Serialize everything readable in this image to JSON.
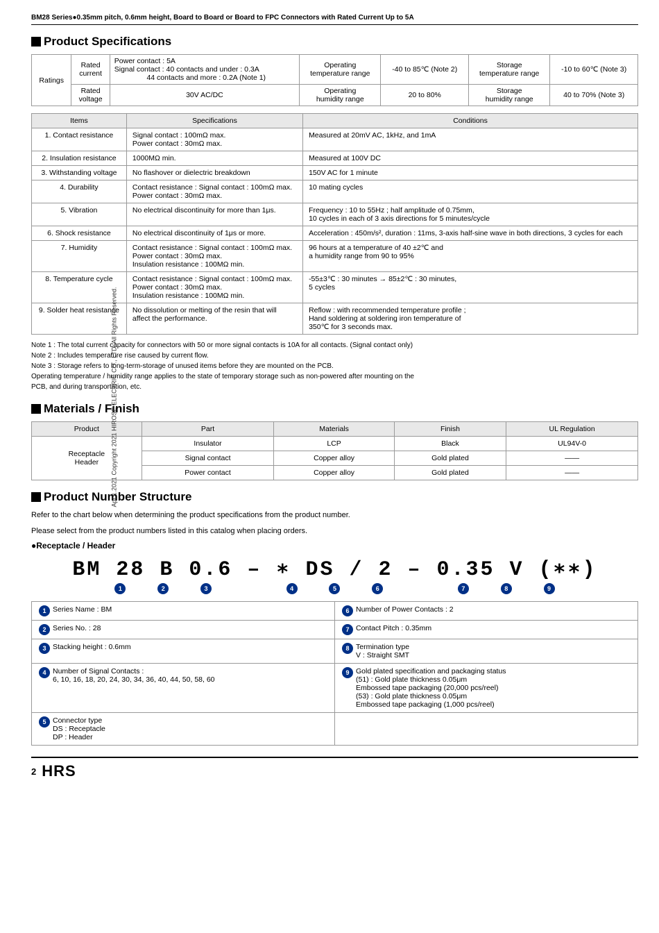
{
  "header": {
    "title": "BM28 Series●0.35mm pitch, 0.6mm height, Board to Board or Board to FPC Connectors with Rated Current Up to 5A"
  },
  "product_specs": {
    "section_title": "Product Specifications",
    "ratings": {
      "rows": [
        {
          "label1": "Rated current",
          "content": "Power contact : 5A\nSignal contact : 40 contacts and under : 0.3A\n44 contacts and more : 0.2A (Note 1)",
          "label2": "Operating temperature range",
          "value2": "-40 to 85℃ (Note 2)",
          "label3": "Storage temperature range",
          "value3": "-10 to 60℃ (Note 3)"
        },
        {
          "label1": "Rated voltage",
          "content": "30V AC/DC",
          "label2": "Operating humidity range",
          "value2": "20 to 80%",
          "label3": "Storage humidity range",
          "value3": "40 to 70% (Note 3)"
        }
      ]
    },
    "specs_header": [
      "Items",
      "Specifications",
      "Conditions"
    ],
    "specs_rows": [
      {
        "item": "1. Contact resistance",
        "spec": "Signal contact : 100mΩ max.\nPower contact : 30mΩ max.",
        "cond": "Measured at 20mV AC, 1kHz, and 1mA"
      },
      {
        "item": "2. Insulation resistance",
        "spec": "1000MΩ min.",
        "cond": "Measured at 100V DC"
      },
      {
        "item": "3. Withstanding voltage",
        "spec": "No flashover or dielectric breakdown",
        "cond": "150V AC for 1 minute"
      },
      {
        "item": "4. Durability",
        "spec": "Contact resistance : Signal contact : 100mΩ max.\nPower contact : 30mΩ max.",
        "cond": "10 mating cycles"
      },
      {
        "item": "5. Vibration",
        "spec": "No electrical discontinuity for more than 1μs.",
        "cond": "Frequency : 10 to 55Hz ; half amplitude of 0.75mm,\n10 cycles in each of 3 axis directions for 5 minutes/cycle"
      },
      {
        "item": "6. Shock resistance",
        "spec": "No electrical discontinuity of 1μs or more.",
        "cond": "Acceleration : 450m/s², duration : 11ms, 3-axis half-sine wave in both directions, 3 cycles for each"
      },
      {
        "item": "7. Humidity",
        "spec": "Contact resistance : Signal contact : 100mΩ max.\nPower contact : 30mΩ max.\nInsulation resistance : 100MΩ min.",
        "cond": "96 hours at a temperature of 40 ±2℃ and\na humidity range from 90 to 95%"
      },
      {
        "item": "8. Temperature cycle",
        "spec": "Contact resistance : Signal contact : 100mΩ max.\nPower contact : 30mΩ max.\nInsulation resistance : 100MΩ min.",
        "cond": "-55±3℃ : 30 minutes → 85±2℃ : 30 minutes,\n5 cycles"
      },
      {
        "item": "9. Solder heat resistance",
        "spec": "No dissolution or melting of the resin that will\naffect the performance.",
        "cond": "Reflow : with recommended temperature profile ;\nHand soldering at soldering iron temperature of\n350℃ for 3 seconds max."
      }
    ],
    "notes": [
      "Note 1 : The total current capacity for connectors with 50 or more signal contacts is 10A for all contacts. (Signal contact only)",
      "Note 2 : Includes temperature rise caused by current flow.",
      "Note 3 : Storage refers to long-term-storage of unused items before they are mounted on the PCB.",
      "         Operating temperature / humidity range applies to the state of temporary storage such as non-powered after mounting on the",
      "         PCB, and during transportation, etc."
    ]
  },
  "materials_finish": {
    "section_title": "Materials / Finish",
    "headers": [
      "Product",
      "Part",
      "Materials",
      "Finish",
      "UL Regulation"
    ],
    "rows": [
      {
        "product": "Receptacle\nHeader",
        "parts": [
          {
            "part": "Insulator",
            "material": "LCP",
            "finish": "Black",
            "ul": "UL94V-0"
          },
          {
            "part": "Signal contact",
            "material": "Copper alloy",
            "finish": "Gold plated",
            "ul": "——"
          },
          {
            "part": "Power contact",
            "material": "Copper alloy",
            "finish": "Gold plated",
            "ul": "——"
          }
        ]
      }
    ]
  },
  "product_number_structure": {
    "section_title": "Product Number Structure",
    "subtitle1": "Refer to the chart below when determining the product specifications from the product number.",
    "subtitle2": "Please select from the product numbers listed in this catalog when placing orders.",
    "bullet_title": "●Receptacle / Header",
    "pn_display": "BM 28 B 0.6 – ∗ DS / 2 – 0.35 V (∗∗)",
    "segments": [
      {
        "text": "BM",
        "num": "❶"
      },
      {
        "text": " 28",
        "num": "❷"
      },
      {
        "text": " B",
        "num": "❸"
      },
      {
        "text": " 0.6",
        "num": ""
      },
      {
        "text": " –",
        "num": ""
      },
      {
        "text": " ∗",
        "num": "❹"
      },
      {
        "text": " DS",
        "num": "❺"
      },
      {
        "text": " /",
        "num": "❻"
      },
      {
        "text": " 2",
        "num": ""
      },
      {
        "text": " –",
        "num": ""
      },
      {
        "text": " 0.35",
        "num": "❼"
      },
      {
        "text": " V",
        "num": "❽"
      },
      {
        "text": " (∗∗)",
        "num": "❾"
      }
    ],
    "descriptions": [
      {
        "left": {
          "num": "❶",
          "label": "Series Name : BM"
        },
        "right": {
          "num": "❻",
          "label": "Number of Power Contacts : 2"
        }
      },
      {
        "left": {
          "num": "❷",
          "label": "Series No. : 28"
        },
        "right": {
          "num": "❼",
          "label": "Contact Pitch : 0.35mm"
        }
      },
      {
        "left": {
          "num": "❸",
          "label": "Stacking height : 0.6mm"
        },
        "right": {
          "num": "❽",
          "label": "Termination type\nV : Straight SMT"
        }
      },
      {
        "left": {
          "num": "❹",
          "label": "Number of Signal Contacts :\n6, 10, 16, 18, 20, 24, 30, 34, 36, 40, 44, 50, 58, 60"
        },
        "right": {
          "num": "❾",
          "label": "Gold plated specification and packaging status\n(51) : Gold plate thickness 0.05μm\n       Embossed tape packaging (20,000 pcs/reel)\n(53) : Gold plate thickness 0.05μm\n       Embossed tape packaging (1,000 pcs/reel)"
        }
      },
      {
        "left": {
          "num": "❺",
          "label": "Connector type\nDS : Receptacle\nDP : Header"
        },
        "right": null
      }
    ]
  },
  "footer": {
    "page_num": "2",
    "logo": "HRS",
    "side_text": "Apr.1.2021 Copyright 2021 HIROSE ELECTRIC CO., LTD. All Rights Reserved."
  }
}
